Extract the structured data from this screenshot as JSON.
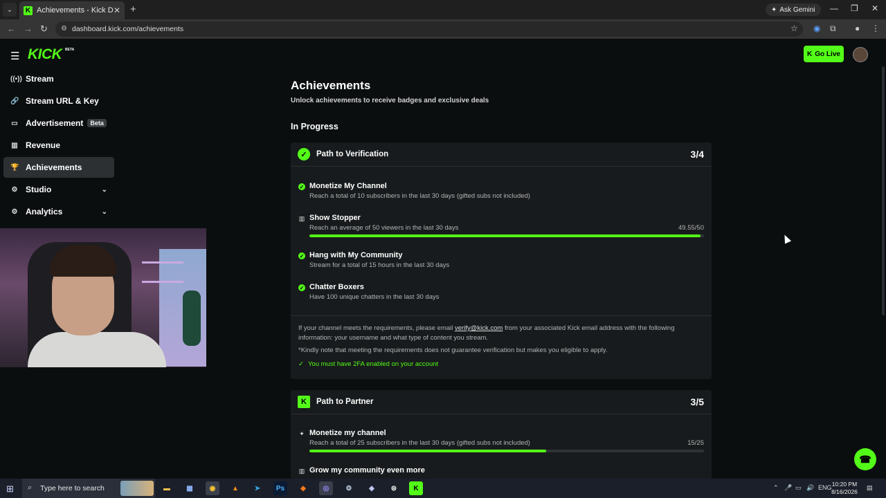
{
  "browser": {
    "tab_title": "Achievements - Kick Dashboard",
    "url": "dashboard.kick.com/achievements",
    "ask_gemini": "Ask Gemini"
  },
  "header": {
    "logo": "KICK",
    "logo_badge": "BETA",
    "go_live": "Go Live"
  },
  "sidebar": {
    "items": [
      {
        "label": "Stream",
        "icon": "broadcast-icon"
      },
      {
        "label": "Stream URL & Key",
        "icon": "link-icon"
      },
      {
        "label": "Advertisement",
        "icon": "window-icon",
        "badge": "Beta"
      },
      {
        "label": "Revenue",
        "icon": "chart-icon"
      },
      {
        "label": "Achievements",
        "icon": "trophy-icon",
        "active": true
      },
      {
        "label": "Studio",
        "icon": "gear-icon",
        "expandable": true
      },
      {
        "label": "Analytics",
        "icon": "gear-icon",
        "expandable": true
      }
    ]
  },
  "page": {
    "title": "Achievements",
    "subtitle": "Unlock achievements to receive badges and exclusive deals",
    "section": "In Progress"
  },
  "verification": {
    "title": "Path to Verification",
    "progress": "3/4",
    "tasks": [
      {
        "title": "Monetize My Channel",
        "desc": "Reach a total of 10 subscribers in the last 30 days (gifted subs not included)",
        "done": true
      },
      {
        "title": "Show Stopper",
        "desc": "Reach an average of 50 viewers in the last 30 days",
        "value": "49.55/50",
        "progress": 0.991,
        "done": false
      },
      {
        "title": "Hang with My Community",
        "desc": "Stream for a total of 15 hours in the last 30 days",
        "done": true
      },
      {
        "title": "Chatter Boxers",
        "desc": "Have 100 unique chatters in the last 30 days",
        "done": true
      }
    ],
    "note_pre": "If your channel meets the requirements, please email ",
    "note_email": "verify@kick.com",
    "note_post": " from your associated Kick email address with the following information: your username and what type of content you stream.",
    "disclaimer": "*Kindly note that meeting the requirements does not guarantee verification but makes you eligible to apply.",
    "requirement": "You must have 2FA enabled on your account"
  },
  "partner": {
    "title": "Path to Partner",
    "progress": "3/5",
    "tasks": [
      {
        "title": "Monetize my channel",
        "desc": "Reach a total of 25 subscribers in the last 30 days (gifted subs not included)",
        "value": "15/25",
        "progress": 0.6,
        "done": false
      },
      {
        "title": "Grow my community even more",
        "done": false
      }
    ]
  },
  "taskbar": {
    "search_placeholder": "Type here to search",
    "language": "ENG",
    "time": "10:20 PM",
    "date": "8/16/2026"
  },
  "colors": {
    "accent": "#53fc18",
    "bg": "#0b0e0f",
    "card": "#181b1d"
  }
}
